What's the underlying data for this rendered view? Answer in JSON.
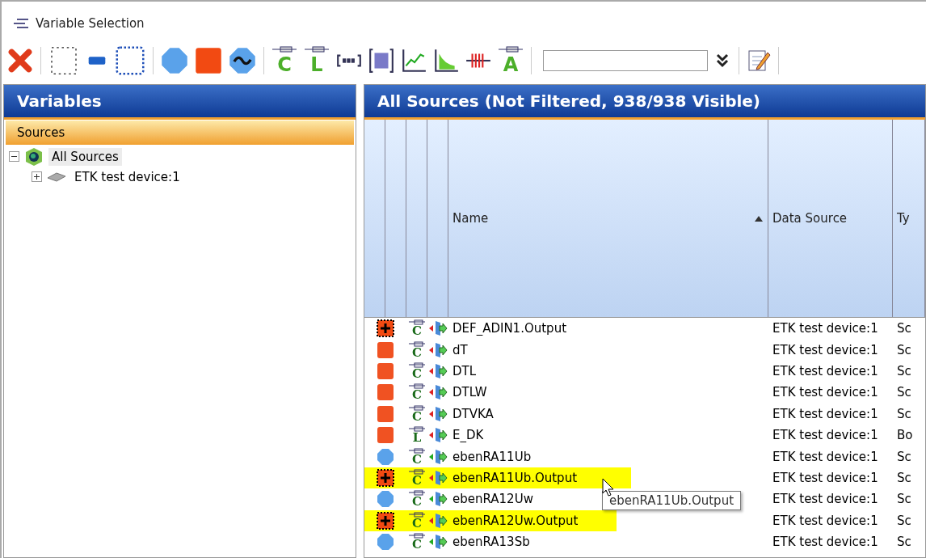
{
  "window": {
    "title": "Variable Selection"
  },
  "toolbar": {
    "type_buttons": [
      "C",
      "L"
    ],
    "text_button": "A"
  },
  "left_panel": {
    "title": "Variables",
    "section": "Sources",
    "tree": [
      {
        "label": "All Sources",
        "kind": "root",
        "expanded": true,
        "selected": true,
        "children": [
          {
            "label": "ETK test device:1",
            "kind": "device",
            "expanded": false,
            "selected": false
          }
        ]
      }
    ]
  },
  "right_panel": {
    "title": "All Sources (Not Filtered, 938/938 Visible)",
    "table": {
      "columns": [
        {
          "label": "Name",
          "sorted": true
        },
        {
          "label": "Data Source",
          "sorted": false
        },
        {
          "label": "Ty",
          "sorted": false
        }
      ],
      "rows": [
        {
          "kind": "measure",
          "type": "C",
          "bidirectional": false,
          "name": "DEF_ADIN1.Output",
          "source": "ETK test device:1",
          "column_3": "Sc",
          "selected": false
        },
        {
          "kind": "parameter",
          "type": "C",
          "bidirectional": false,
          "name": "dT",
          "source": "ETK test device:1",
          "column_3": "Sc",
          "selected": false
        },
        {
          "kind": "parameter",
          "type": "C",
          "bidirectional": false,
          "name": "DTL",
          "source": "ETK test device:1",
          "column_3": "Sc",
          "selected": false
        },
        {
          "kind": "parameter",
          "type": "C",
          "bidirectional": false,
          "name": "DTLW",
          "source": "ETK test device:1",
          "column_3": "Sc",
          "selected": false
        },
        {
          "kind": "parameter",
          "type": "C",
          "bidirectional": false,
          "name": "DTVKA",
          "source": "ETK test device:1",
          "column_3": "Sc",
          "selected": false
        },
        {
          "kind": "parameter",
          "type": "L",
          "bidirectional": false,
          "name": "E_DK",
          "source": "ETK test device:1",
          "column_3": "Bo",
          "selected": false
        },
        {
          "kind": "signal",
          "type": "C",
          "bidirectional": true,
          "name": "ebenRA11Ub",
          "source": "ETK test device:1",
          "column_3": "Sc",
          "selected": false
        },
        {
          "kind": "measure",
          "type": "C",
          "bidirectional": false,
          "name": "ebenRA11Ub.Output",
          "source": "ETK test device:1",
          "column_3": "Sc",
          "selected": true
        },
        {
          "kind": "signal",
          "type": "C",
          "bidirectional": true,
          "name": "ebenRA12Uw",
          "source": "ETK test device:1",
          "column_3": "Sc",
          "selected": false
        },
        {
          "kind": "measure",
          "type": "C",
          "bidirectional": false,
          "name": "ebenRA12Uw.Output",
          "source": "ETK test device:1",
          "column_3": "Sc",
          "selected": true
        },
        {
          "kind": "signal",
          "type": "C",
          "bidirectional": true,
          "name": "ebenRA13Sb",
          "source": "ETK test device:1",
          "column_3": "Sc",
          "selected": false
        }
      ]
    },
    "tooltip": "ebenRA11Ub.Output"
  }
}
